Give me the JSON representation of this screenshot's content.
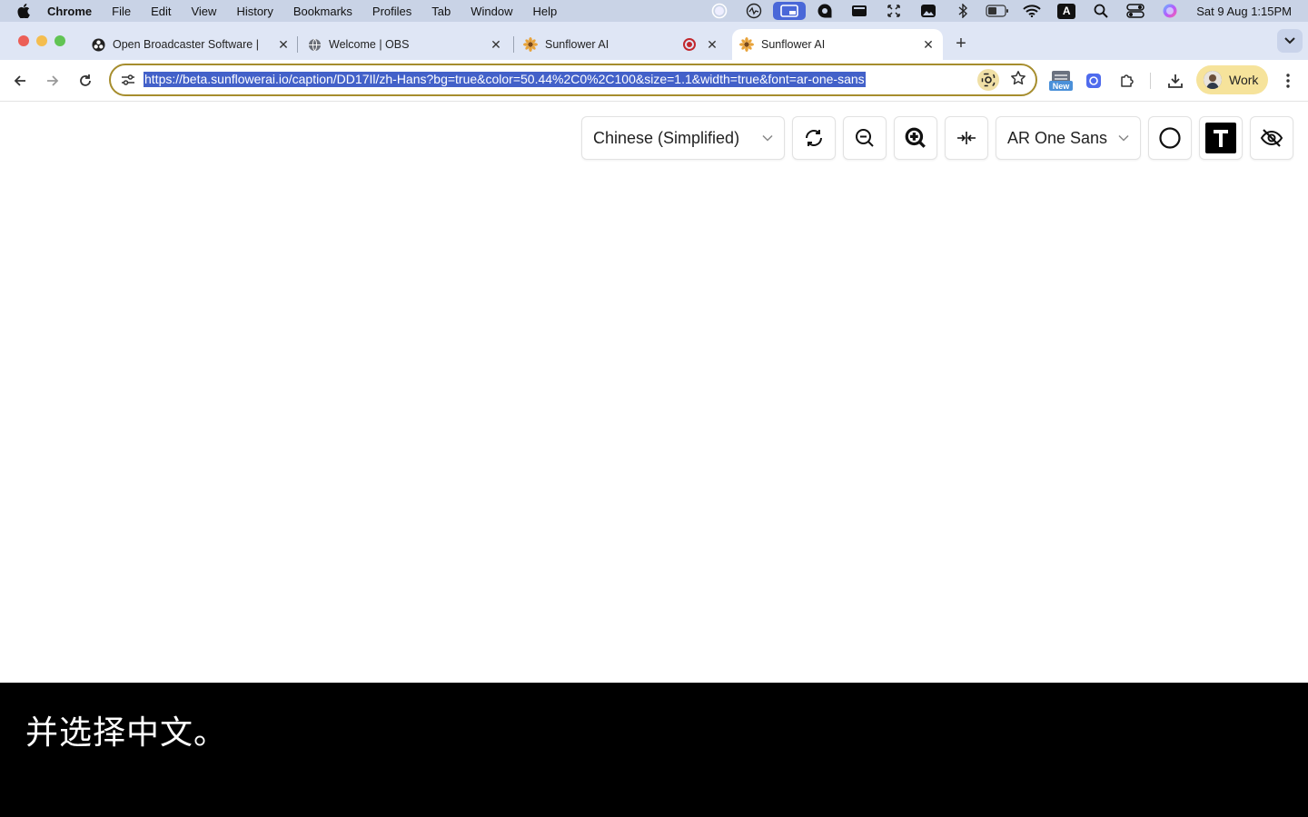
{
  "menubar": {
    "app_name": "Chrome",
    "items": [
      "File",
      "Edit",
      "View",
      "History",
      "Bookmarks",
      "Profiles",
      "Tab",
      "Window",
      "Help"
    ],
    "status_icons": [
      "screen-record-icon",
      "activity-icon",
      "screen-share-icon",
      "chat-icon",
      "battery-widget-icon",
      "move-icon",
      "photos-icon",
      "bluetooth-icon",
      "battery-icon",
      "wifi-icon",
      "input-source-icon",
      "spotlight-icon",
      "control-center-icon",
      "siri-icon"
    ],
    "input_source": "A",
    "clock": "Sat 9 Aug  1:15PM"
  },
  "tabs": [
    {
      "title": "Open Broadcaster Software |",
      "favicon": "obs-icon",
      "active": false
    },
    {
      "title": "Welcome | OBS",
      "favicon": "globe-icon",
      "active": false
    },
    {
      "title": "Sunflower AI",
      "favicon": "sunflower-icon",
      "active": false,
      "recording": true
    },
    {
      "title": "Sunflower AI",
      "favicon": "sunflower-icon",
      "active": true
    }
  ],
  "toolbar": {
    "url": "https://beta.sunflowerai.io/caption/DD17Il/zh-Hans?bg=true&color=50.44%2C0%2C100&size=1.1&width=true&font=ar-one-sans",
    "extension_new_badge": "New",
    "profile_label": "Work"
  },
  "controls": {
    "language": "Chinese (Simplified)",
    "font": "AR One Sans"
  },
  "caption": {
    "text": "并选择中文。"
  },
  "colors": {
    "omnibox_border": "#a68d2d",
    "url_highlight": "#4361c9",
    "profile_chip": "#f6e39b",
    "caption_bg": "#000000",
    "caption_text": "#ffffff"
  }
}
